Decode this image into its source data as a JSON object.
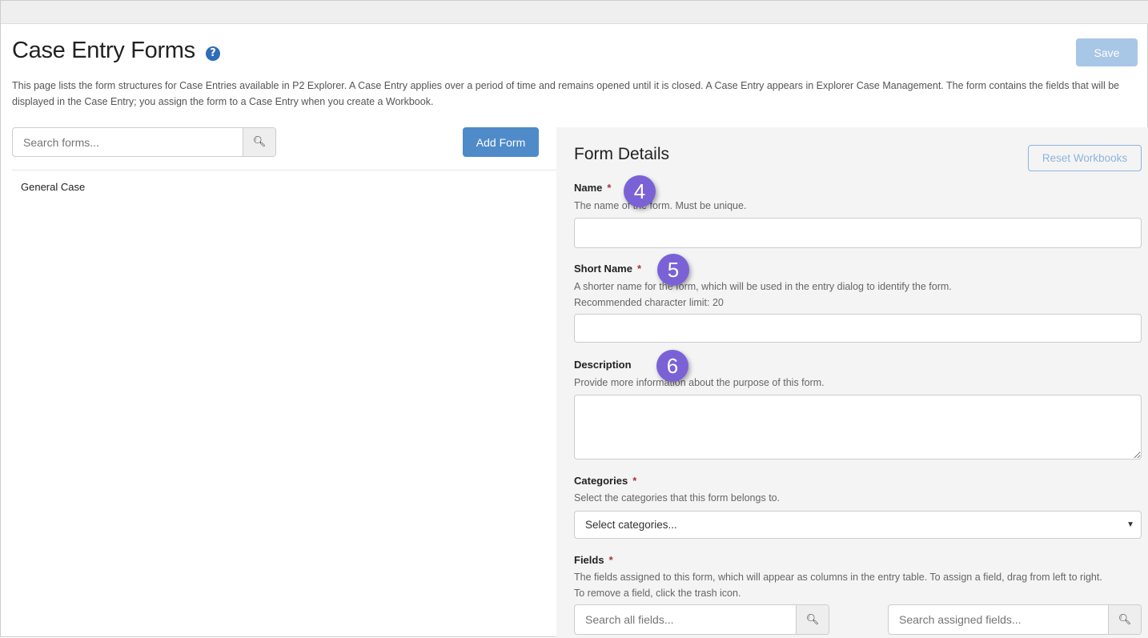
{
  "header": {
    "title": "Case Entry Forms",
    "help_icon": "?",
    "save_label": "Save",
    "intro": "This page lists the form structures for Case Entries available in P2 Explorer. A Case Entry applies over a period of time and remains opened until it is closed. A Case Entry appears in Explorer Case Management. The form contains the fields that will be displayed in the Case Entry; you assign the form to a Case Entry when you create a Workbook."
  },
  "left": {
    "search_placeholder": "Search forms...",
    "add_label": "Add Form",
    "forms": [
      "General Case"
    ]
  },
  "details": {
    "title": "Form Details",
    "reset_label": "Reset Workbooks",
    "name": {
      "label": "Name",
      "required": "*",
      "hint": "The name of the form. Must be unique.",
      "value": ""
    },
    "short_name": {
      "label": "Short Name",
      "required": "*",
      "hint": "A shorter name for the form, which will be used in the entry dialog to identify the form.",
      "hint2": "Recommended character limit: 20",
      "value": ""
    },
    "description": {
      "label": "Description",
      "hint": "Provide more information about the purpose of this form.",
      "value": ""
    },
    "categories": {
      "label": "Categories",
      "required": "*",
      "hint": "Select the categories that this form belongs to.",
      "selected": "Select categories..."
    },
    "fields": {
      "label": "Fields",
      "required": "*",
      "hint": "The fields assigned to this form, which will appear as columns in the entry table. To assign a field, drag from left to right.",
      "hint2": "To remove a field, click the trash icon.",
      "search_all_placeholder": "Search all fields...",
      "search_assigned_placeholder": "Search assigned fields..."
    }
  },
  "annotations": [
    "4",
    "5",
    "6"
  ],
  "colors": {
    "primary": "#4f8ac9",
    "badge": "#7a62d6",
    "required": "#aa3333"
  }
}
